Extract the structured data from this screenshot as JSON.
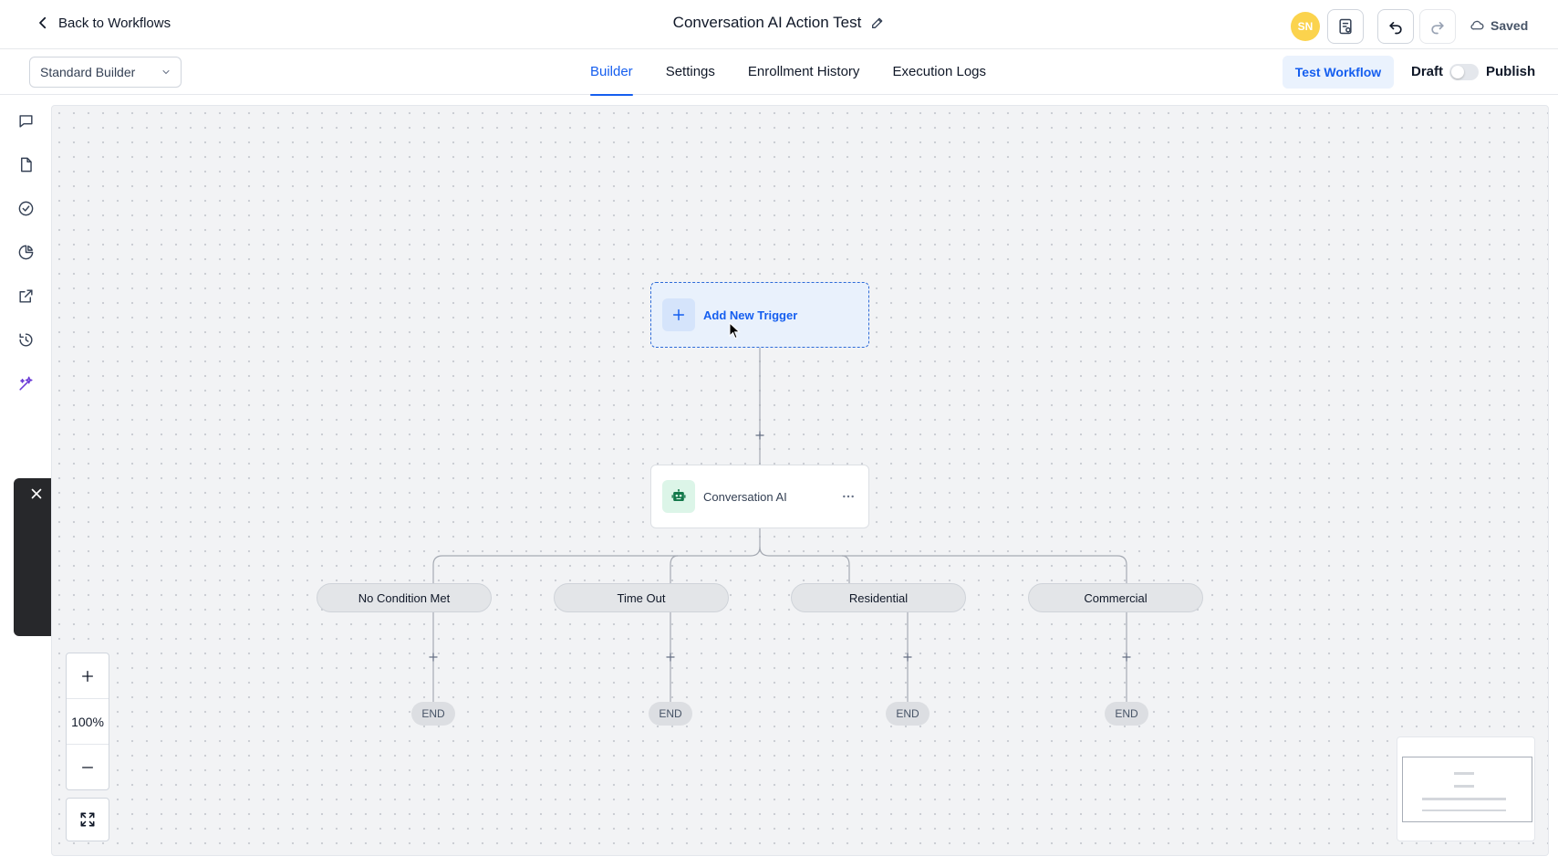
{
  "header": {
    "back_label": "Back to Workflows",
    "title": "Conversation AI Action Test",
    "avatar_initials": "SN",
    "avatar_color": "#fbd34d",
    "status": "Saved"
  },
  "subbar": {
    "builder_mode": "Standard Builder",
    "tabs": [
      {
        "label": "Builder",
        "active": true
      },
      {
        "label": "Settings",
        "active": false
      },
      {
        "label": "Enrollment History",
        "active": false
      },
      {
        "label": "Execution Logs",
        "active": false
      }
    ],
    "test_button": "Test Workflow",
    "draft_label": "Draft",
    "publish_label": "Publish",
    "publish_toggle_on": false
  },
  "rail": {
    "icons": [
      "chat-icon",
      "file-icon",
      "check-circle-icon",
      "pie-chart-icon",
      "external-link-icon",
      "history-icon",
      "sparkle-icon"
    ]
  },
  "canvas": {
    "trigger": {
      "label": "Add New Trigger"
    },
    "action": {
      "label": "Conversation AI"
    },
    "branches": [
      {
        "label": "No Condition Met",
        "end_label": "END"
      },
      {
        "label": "Time Out",
        "end_label": "END"
      },
      {
        "label": "Residential",
        "end_label": "END"
      },
      {
        "label": "Commercial",
        "end_label": "END"
      }
    ]
  },
  "zoom": {
    "level": "100%"
  },
  "colors": {
    "accent": "#155eef",
    "trigger_bg": "#e9f1fc",
    "ai_icon_bg": "#dcf5e8"
  }
}
